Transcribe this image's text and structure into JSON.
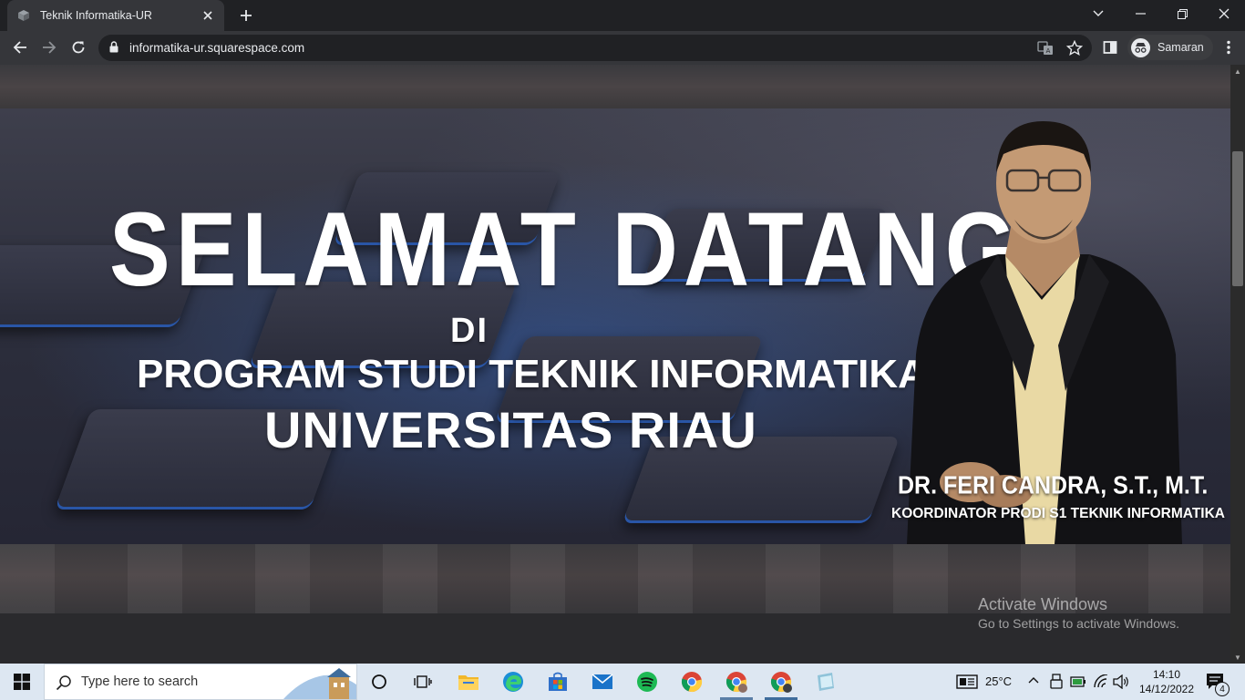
{
  "browser": {
    "tab_title": "Teknik Informatika-UR",
    "url": "informatika-ur.squarespace.com",
    "profile_name": "Samaran"
  },
  "banner": {
    "headline": "SELAMAT DATANG",
    "line_di": "DI",
    "line_program": "PROGRAM STUDI TEKNIK INFORMATIKA",
    "line_university": "UNIVERSITAS RIAU",
    "person_name": "DR. FERI CANDRA, S.T., M.T.",
    "person_title": "KOORDINATOR PRODI S1 TEKNIK INFORMATIKA"
  },
  "watermark": {
    "line1": "Activate Windows",
    "line2": "Go to Settings to activate Windows."
  },
  "taskbar": {
    "search_placeholder": "Type here to search",
    "temperature": "25°C",
    "time": "14:10",
    "date": "14/12/2022",
    "notification_count": "4"
  },
  "colors": {
    "chrome_dark": "#202124",
    "chrome_toolbar": "#35363a",
    "taskbar": "#dde7f2",
    "banner_text": "#ffffff"
  }
}
